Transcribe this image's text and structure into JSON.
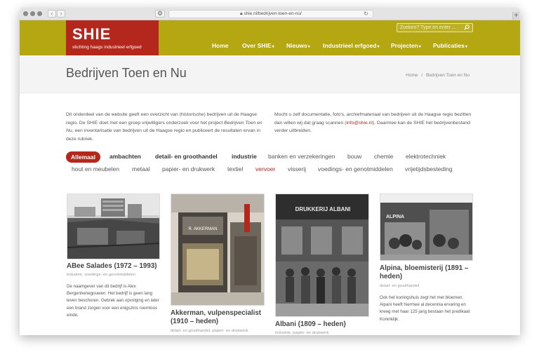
{
  "browser": {
    "url": "shie.nl/bedrijven-toen-en-nu/"
  },
  "header": {
    "logo_title": "SHIE",
    "logo_subtitle": "stichting haags industrieel erfgoed",
    "search_placeholder": "Zoeken? Type en enter ...",
    "nav": [
      {
        "label": "Home"
      },
      {
        "label": "Over SHIE"
      },
      {
        "label": "Nieuws"
      },
      {
        "label": "Industrieel erfgoed"
      },
      {
        "label": "Projecten"
      },
      {
        "label": "Publicaties"
      }
    ]
  },
  "titlebar": {
    "title": "Bedrijven Toen en Nu",
    "breadcrumb_home": "Home",
    "breadcrumb_sep": "/",
    "breadcrumb_current": "Bedrijven Toen en Nu"
  },
  "intro": {
    "left_1": "Dit onderdeel van de website geeft een overzicht van (historische) bedrijven uit de Haagse",
    "left_2": "regio. De SHIE doet met een groep vrijwilligers onderzoek voor het project ",
    "left_2_italic": "Bedrijven Toen en",
    "left_3_italic": "Nu",
    "left_3": ", een inventarisatie van bedrijven uit de Haagse regio en publiceert de resultaten ervan in",
    "left_4": "deze rubriek.",
    "right_1": "Mocht u zelf documentatie, foto's, archiefmateriaal van bedrijven uit de Haagse regio bezitten",
    "right_2": "dan willen wij dat graag scannen (",
    "right_email": "info@shie.nl",
    "right_2b": "). Daarmee kan de SHIE het bedrijvenbestand",
    "right_3": "verder uitbreiden."
  },
  "filters_row1": [
    {
      "label": "Allemaal"
    },
    {
      "label": "ambachten"
    },
    {
      "label": "detail- en groothandel"
    },
    {
      "label": "industrie"
    },
    {
      "label": "banken en verzekeringen"
    },
    {
      "label": "bouw"
    },
    {
      "label": "chemie"
    },
    {
      "label": "elektrotechniek"
    }
  ],
  "filters_row2": [
    {
      "label": "hout en meubelen"
    },
    {
      "label": "metaal"
    },
    {
      "label": "papier- en drukwerk"
    },
    {
      "label": "textiel"
    },
    {
      "label": "vervoer"
    },
    {
      "label": "visserij"
    },
    {
      "label": "voedings- en genotmiddelen"
    },
    {
      "label": "vrijetijdsbesteding"
    }
  ],
  "cards": [
    {
      "title_1": "ABee Salades (1972 – 1993)",
      "category": "industrie, voedings- en genotmiddelen",
      "desc_1": "De naamgever van dit bedrijf is Alex",
      "desc_2": "Bergenhenegouwen. Het bedrijf is geen lang",
      "desc_3": "leven beschoren. Gebrek aan opvolging en later",
      "desc_4": "een brand zorgen voor een enigszins roemloos",
      "desc_5": "einde."
    },
    {
      "title_1": "Akkerman, vulpenspecialist",
      "title_2": "(1910 – heden)",
      "category": "detail- en groothandel, papier- en drukwerk",
      "photo_text": "R. AKKERMAN"
    },
    {
      "title_1": "Albani (1809 – heden)",
      "category": "industrie, papier- en drukwerk",
      "photo_text": "DRUKKERIJ ALBANI"
    },
    {
      "title_1": "Alpina, bloemisterij (1891 –",
      "title_2": "heden)",
      "category": "detail- en groothandel",
      "photo_text": "ALPINA",
      "desc_1": "Ook het koningshuis zegt het met bloemen.",
      "desc_2": "Alpani heeft hiermee al decennia ervaring en",
      "desc_3": "kreeg met haar 125 jarig bestaan het predikaat",
      "desc_4": "Koninklijk."
    }
  ]
}
